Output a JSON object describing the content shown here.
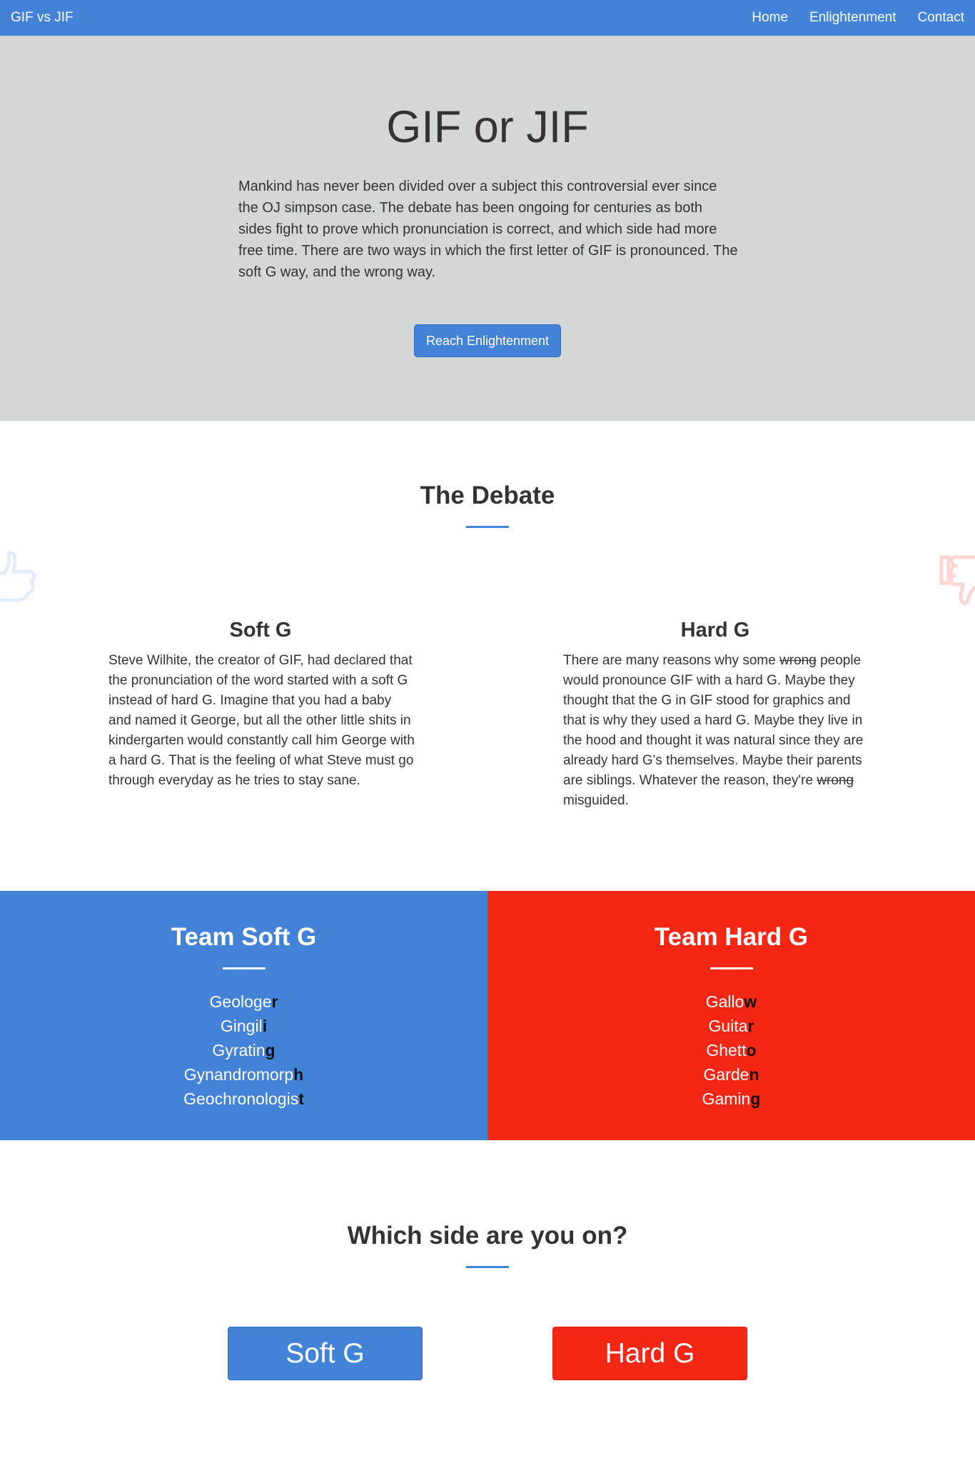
{
  "navbar": {
    "brand": "GIF vs JIF",
    "links": [
      "Home",
      "Enlightenment",
      "Contact"
    ]
  },
  "hero": {
    "title": "GIF or JIF",
    "text": "Mankind has never been divided over a subject this controversial ever since the OJ simpson case. The debate has been ongoing for centuries as both sides fight to prove which pronunciation is correct, and which side had more free time. There are two ways in which the first letter of GIF is pronounced. The soft G way, and the wrong way.",
    "button_label": "Reach Enlightenment"
  },
  "debate": {
    "heading": "The Debate",
    "soft": {
      "title": "Soft G",
      "text": "Steve Wilhite, the creator of GIF, had declared that the pronunciation of the word started with a soft G instead of hard G. Imagine that you had a baby and named it George, but all the other little shits in kindergarten would constantly call him George with a hard G. That is the feeling of what Steve must go through everyday as he tries to stay sane."
    },
    "hard": {
      "title": "Hard G",
      "text_1": "There are many reasons why some ",
      "strike_1": "wrong",
      "text_2": " people would pronounce GIF with a hard G. Maybe they thought that the G in GIF stood for graphics and that is why they used a hard G. Maybe they live in the hood and thought it was natural since they are already hard G's themselves. Maybe their parents are siblings. Whatever the reason, they're ",
      "strike_2": "wrong",
      "text_3": " misguided."
    },
    "icons": [
      "thumbs-up-icon",
      "thumbs-down-icon"
    ]
  },
  "teams": {
    "soft": {
      "title": "Team Soft G",
      "words": [
        {
          "start": "Geologe",
          "end": "r"
        },
        {
          "start": "Gingil",
          "end": "i"
        },
        {
          "start": "Gyratin",
          "end": "g"
        },
        {
          "start": "Gynandromorp",
          "end": "h"
        },
        {
          "start": "Geochronologis",
          "end": "t"
        }
      ]
    },
    "hard": {
      "title": "Team Hard G",
      "words": [
        {
          "start": "Gallo",
          "end": "w"
        },
        {
          "start": "Guita",
          "end": "r"
        },
        {
          "start": "Ghett",
          "end": "o"
        },
        {
          "start": "Garde",
          "end": "n"
        },
        {
          "start": "Gamin",
          "end": "g"
        }
      ]
    }
  },
  "choose": {
    "heading": "Which side are you on?",
    "soft_label": "Soft G",
    "hard_label": "Hard G"
  },
  "colors": {
    "blue": "#4283d8",
    "red": "#f32714",
    "hero_bg": "#d3d7d5"
  }
}
